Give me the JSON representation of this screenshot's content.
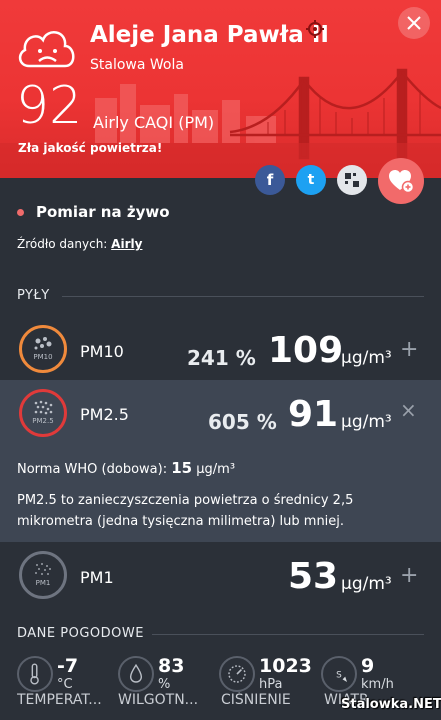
{
  "location": {
    "name": "Aleje Jana Pawła II",
    "city": "Stalowa Wola"
  },
  "aqi": {
    "value": "92",
    "label": "Airly CAQI (PM)",
    "quality_text": "Zła jakość powietrza!"
  },
  "share": {
    "facebook": "f",
    "twitter": "t"
  },
  "live": {
    "label": "Pomiar na żywo"
  },
  "source": {
    "prefix": "Źródło danych:",
    "provider": "Airly"
  },
  "sections": {
    "dust": "PYŁY",
    "weather": "DANE POGODOWE"
  },
  "particles": [
    {
      "name": "PM10",
      "icon_label": "PM10",
      "percent": "241 %",
      "value": "109",
      "unit": "µg/m³",
      "toggle": "+",
      "ring_color": "#f08a3c"
    },
    {
      "name": "PM2.5",
      "icon_label": "PM2.5",
      "percent": "605 %",
      "value": "91",
      "unit": "µg/m³",
      "toggle": "×",
      "ring_color": "#e03a3a"
    },
    {
      "name": "PM1",
      "icon_label": "PM1",
      "percent": "",
      "value": "53",
      "unit": "µg/m³",
      "toggle": "+",
      "ring_color": "#6e7480"
    }
  ],
  "pm25_details": {
    "norm_label": "Norma WHO (dobowa):",
    "norm_value": "15",
    "norm_unit": "µg/m³",
    "description": "PM2.5 to zanieczyszczenia powietrza o średnicy 2,5 mikrometra (jedna tysięczna milimetra) lub mniej."
  },
  "weather": [
    {
      "icon": "thermometer-icon",
      "value": "-7",
      "unit": "°C",
      "label": "TEMPERAT..."
    },
    {
      "icon": "humidity-icon",
      "value": "83",
      "unit": "%",
      "label": "WILGOTN..."
    },
    {
      "icon": "pressure-gauge-icon",
      "value": "1023",
      "unit": "hPa",
      "label": "CIŚNIENIE"
    },
    {
      "icon": "wind-compass-icon",
      "value": "9",
      "unit": "km/h",
      "label": "WIATR"
    }
  ],
  "watermark": "Stalowka.NET"
}
